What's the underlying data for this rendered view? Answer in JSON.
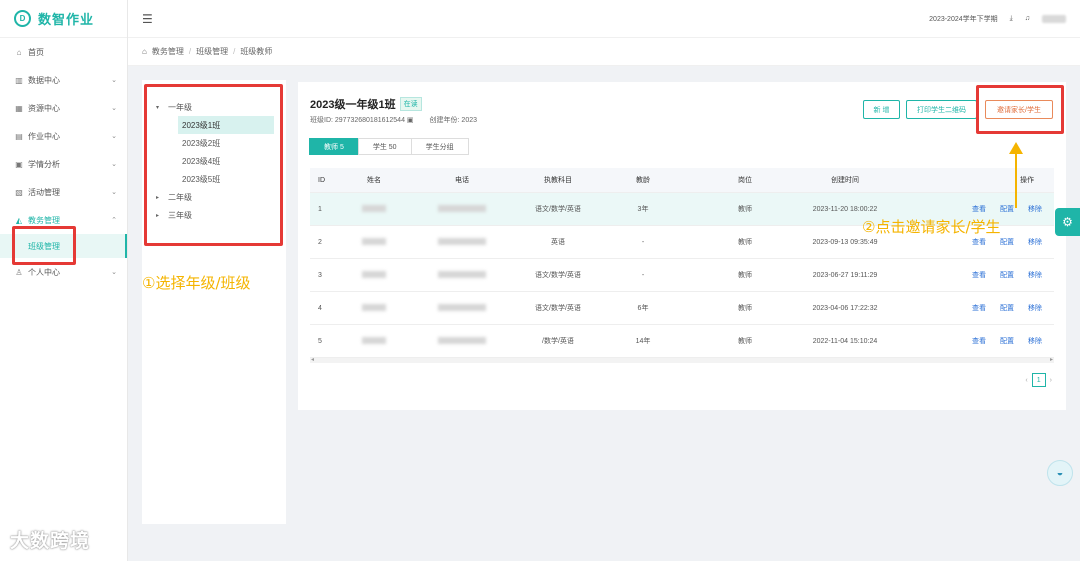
{
  "app": {
    "name": "数智作业",
    "logo_mark": "D"
  },
  "sidebar": {
    "items": [
      {
        "label": "首页",
        "icon": "⌂",
        "has_children": false
      },
      {
        "label": "数据中心",
        "icon": "▥",
        "has_children": true
      },
      {
        "label": "资源中心",
        "icon": "▦",
        "has_children": true
      },
      {
        "label": "作业中心",
        "icon": "▤",
        "has_children": true
      },
      {
        "label": "学情分析",
        "icon": "▣",
        "has_children": true
      },
      {
        "label": "活动管理",
        "icon": "▧",
        "has_children": true
      },
      {
        "label": "教务管理",
        "icon": "◭",
        "has_children": true,
        "expanded": true
      },
      {
        "label": "个人中心",
        "icon": "♙",
        "has_children": true
      }
    ],
    "active_sub": "班级管理"
  },
  "header": {
    "menu_icon": "☰",
    "term": "2023-2024学年下学期",
    "download_icon": "⤓",
    "bell_icon": "♫"
  },
  "breadcrumb": {
    "home_icon": "⌂",
    "items": [
      "教务管理",
      "班级管理",
      "班级教师"
    ]
  },
  "tree": {
    "grade1": "一年级",
    "classes": [
      "2023级1班",
      "2023级2班",
      "2023级4班",
      "2023级5班"
    ],
    "grade2": "二年级",
    "grade3": "三年级",
    "expanded_arrow": "▾",
    "collapsed_arrow": "▸"
  },
  "class_info": {
    "title": "2023级一年级1班",
    "status": "在读",
    "class_id_label": "班级ID: 297732680181612544 ▣",
    "created_year_label": "创建年份: 2023"
  },
  "buttons": {
    "add": "新 增",
    "print_qr": "打印学生二维码",
    "invite": "邀请家长/学生"
  },
  "tabs": [
    "教师 5",
    "学生 50",
    "学生分组"
  ],
  "table": {
    "headers": [
      "ID",
      "姓名",
      "电话",
      "执教科目",
      "教龄",
      "岗位",
      "创建时间",
      "操作"
    ],
    "rows": [
      {
        "id": "1",
        "subject": "语文/数学/英语",
        "age": "3年",
        "post": "教师",
        "time": "2023-11-20 18:00:22"
      },
      {
        "id": "2",
        "subject": "英语",
        "age": "-",
        "post": "教师",
        "time": "2023-09-13 09:35:49"
      },
      {
        "id": "3",
        "subject": "语文/数学/英语",
        "age": "-",
        "post": "教师",
        "time": "2023-06-27 19:11:29"
      },
      {
        "id": "4",
        "subject": "语文/数学/英语",
        "age": "6年",
        "post": "教师",
        "time": "2023-04-06 17:22:32"
      },
      {
        "id": "5",
        "subject": "/数学/英语",
        "age": "14年",
        "post": "教师",
        "time": "2022-11-04 15:10:24"
      }
    ],
    "ops": [
      "查看",
      "配置",
      "移除"
    ]
  },
  "pager": {
    "prev": "‹",
    "page": "1",
    "next": "›"
  },
  "annotations": {
    "step1": "①选择年级/班级",
    "step2": "②点击邀请家长/学生"
  },
  "float": {
    "settings_icon": "⚙",
    "robot_icon": "◒"
  },
  "watermark": "大数跨境"
}
